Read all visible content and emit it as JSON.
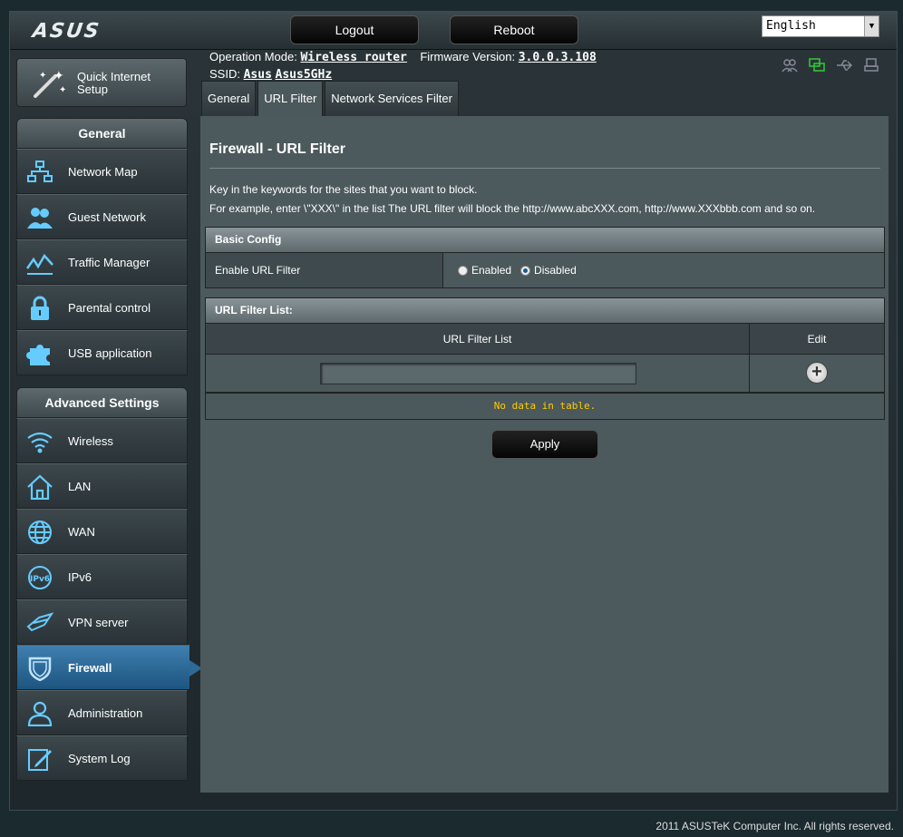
{
  "header": {
    "logo": "ASUS",
    "logout_label": "Logout",
    "reboot_label": "Reboot",
    "language": "English"
  },
  "info": {
    "op_mode_label": "Operation Mode:",
    "op_mode_value": "Wireless router",
    "firmware_label": "Firmware Version:",
    "firmware_value": "3.0.0.3.108",
    "ssid_label": "SSID:",
    "ssid_1": "Asus",
    "ssid_2": "Asus5GHz"
  },
  "sidebar": {
    "quick_setup": "Quick Internet Setup",
    "general_title": "General",
    "general_items": [
      {
        "label": "Network Map",
        "icon": "network-map-icon"
      },
      {
        "label": "Guest Network",
        "icon": "guest-network-icon"
      },
      {
        "label": "Traffic Manager",
        "icon": "traffic-manager-icon"
      },
      {
        "label": "Parental control",
        "icon": "parental-control-icon"
      },
      {
        "label": "USB application",
        "icon": "usb-application-icon"
      }
    ],
    "advanced_title": "Advanced Settings",
    "advanced_items": [
      {
        "label": "Wireless",
        "icon": "wireless-icon"
      },
      {
        "label": "LAN",
        "icon": "lan-icon"
      },
      {
        "label": "WAN",
        "icon": "wan-icon"
      },
      {
        "label": "IPv6",
        "icon": "ipv6-icon"
      },
      {
        "label": "VPN server",
        "icon": "vpn-server-icon"
      },
      {
        "label": "Firewall",
        "icon": "firewall-icon"
      },
      {
        "label": "Administration",
        "icon": "administration-icon"
      },
      {
        "label": "System Log",
        "icon": "system-log-icon"
      }
    ]
  },
  "tabs": [
    "General",
    "URL Filter",
    "Network Services Filter"
  ],
  "content": {
    "title": "Firewall - URL Filter",
    "desc_1": "Key in the keywords for the sites that you want to block.",
    "desc_2": "For example, enter \\\"XXX\\\" in the list The URL filter will block the http://www.abcXXX.com, http://www.XXXbbb.com and so on.",
    "basic_config_title": "Basic Config",
    "enable_label": "Enable URL Filter",
    "enabled_label": "Enabled",
    "disabled_label": "Disabled",
    "list_section_title": "URL Filter List:",
    "list_col_1": "URL Filter List",
    "list_col_2": "Edit",
    "no_data": "No data in table.",
    "apply_label": "Apply"
  },
  "footer": "2011 ASUSTeK Computer Inc. All rights reserved.",
  "colors": {
    "accent": "#1d5580",
    "no_data": "#ffcc00"
  }
}
